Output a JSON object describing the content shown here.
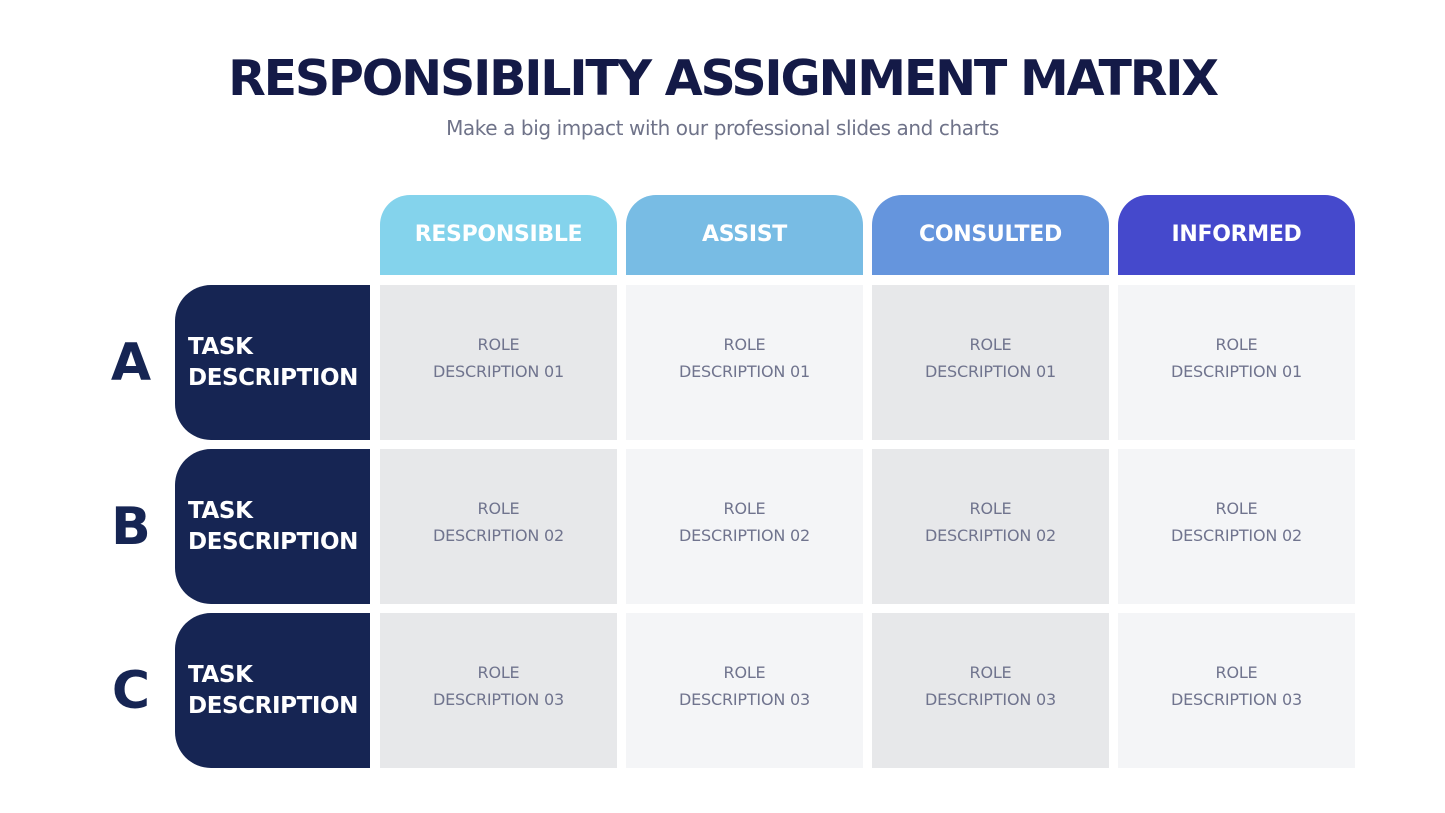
{
  "header": {
    "title": "RESPONSIBILITY ASSIGNMENT MATRIX",
    "subtitle": "Make a big impact with our professional slides and charts"
  },
  "columns": [
    {
      "label": "RESPONSIBLE",
      "color": "#84d3ec"
    },
    {
      "label": "ASSIST",
      "color": "#78bce4"
    },
    {
      "label": "CONSULTED",
      "color": "#6595dd"
    },
    {
      "label": "INFORMED",
      "color": "#4549cc"
    }
  ],
  "rows": [
    {
      "letter": "A",
      "task_line1": "TASK",
      "task_line2": "DESCRIPTION",
      "cells": [
        {
          "line1": "ROLE",
          "line2": "DESCRIPTION 01"
        },
        {
          "line1": "ROLE",
          "line2": "DESCRIPTION 01"
        },
        {
          "line1": "ROLE",
          "line2": "DESCRIPTION 01"
        },
        {
          "line1": "ROLE",
          "line2": "DESCRIPTION 01"
        }
      ]
    },
    {
      "letter": "B",
      "task_line1": "TASK",
      "task_line2": "DESCRIPTION",
      "cells": [
        {
          "line1": "ROLE",
          "line2": "DESCRIPTION 02"
        },
        {
          "line1": "ROLE",
          "line2": "DESCRIPTION 02"
        },
        {
          "line1": "ROLE",
          "line2": "DESCRIPTION 02"
        },
        {
          "line1": "ROLE",
          "line2": "DESCRIPTION 02"
        }
      ]
    },
    {
      "letter": "C",
      "task_line1": "TASK",
      "task_line2": "DESCRIPTION",
      "cells": [
        {
          "line1": "ROLE",
          "line2": "DESCRIPTION 03"
        },
        {
          "line1": "ROLE",
          "line2": "DESCRIPTION 03"
        },
        {
          "line1": "ROLE",
          "line2": "DESCRIPTION 03"
        },
        {
          "line1": "ROLE",
          "line2": "DESCRIPTION 03"
        }
      ]
    }
  ],
  "colors": {
    "title": "#141a47",
    "subtitle": "#6f7389",
    "task_box": "#162553",
    "cell_dark": "#e7e8ea",
    "cell_light": "#f4f5f7",
    "cell_text": "#70748e"
  }
}
